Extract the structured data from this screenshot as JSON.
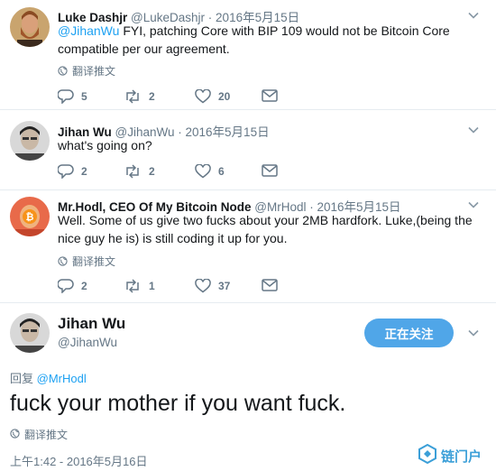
{
  "tweets": [
    {
      "name": "Luke Dashjr",
      "handle": "@LukeDashjr",
      "date": "2016年5月15日",
      "mention": "@JihanWu",
      "text": " FYI, patching Core with BIP 109 would not be Bitcoin Core compatible per our agreement.",
      "translate": "翻译推文",
      "replies": "5",
      "retweets": "2",
      "likes": "20"
    },
    {
      "name": "Jihan Wu",
      "handle": "@JihanWu",
      "date": "2016年5月15日",
      "text": "what's going on?",
      "replies": "2",
      "retweets": "2",
      "likes": "6"
    },
    {
      "name": "Mr.Hodl, CEO Of My Bitcoin Node",
      "handle": "@MrHodl",
      "date": "2016年5月15日",
      "text": "Well. Some of us give two fucks about your 2MB hardfork. Luke,(being the nice guy he is) is still coding it up for you.",
      "translate": "翻译推文",
      "replies": "2",
      "retweets": "1",
      "likes": "37"
    }
  ],
  "main_tweet": {
    "name": "Jihan Wu",
    "handle": "@JihanWu",
    "follow_label": "正在关注",
    "reply_prefix": "回复",
    "reply_mention": "@MrHodl",
    "text": "fuck your mother if you want fuck.",
    "translate": "翻译推文",
    "timestamp": "上午1:42 - 2016年5月16日"
  },
  "watermark": {
    "text": "链门户"
  },
  "colors": {
    "accent": "#1da1f2",
    "follow_button": "#50a6e8",
    "secondary_text": "#657786",
    "divider": "#e6ecf0"
  },
  "separator": " · "
}
